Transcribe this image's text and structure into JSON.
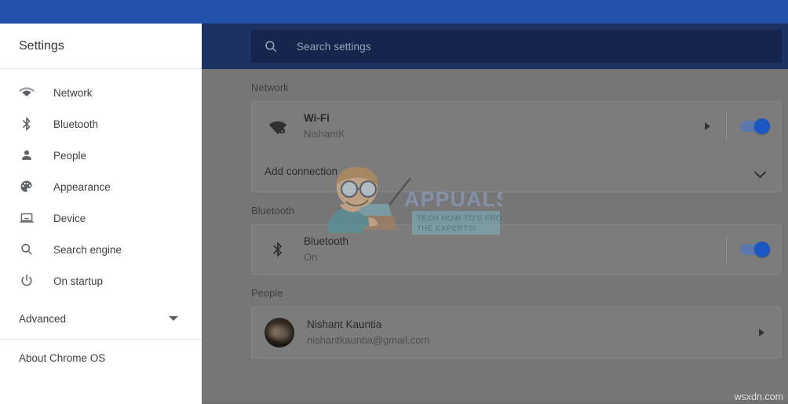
{
  "window": {
    "top_bar_color": "#2351ab",
    "header_color": "#1b3263",
    "dim_overlay_color": "#767676"
  },
  "sidebar": {
    "title": "Settings",
    "items": [
      {
        "label": "Network",
        "icon": "wifi-icon"
      },
      {
        "label": "Bluetooth",
        "icon": "bluetooth-icon"
      },
      {
        "label": "People",
        "icon": "person-icon"
      },
      {
        "label": "Appearance",
        "icon": "palette-icon"
      },
      {
        "label": "Device",
        "icon": "laptop-icon"
      },
      {
        "label": "Search engine",
        "icon": "search-icon"
      },
      {
        "label": "On startup",
        "icon": "power-icon"
      }
    ],
    "advanced": {
      "label": "Advanced",
      "icon": "chevron-down-icon"
    },
    "about": {
      "label": "About Chrome OS"
    }
  },
  "search": {
    "placeholder": "Search settings",
    "value": "",
    "icon": "search-icon"
  },
  "sections": {
    "network": {
      "title": "Network",
      "wifi": {
        "title": "Wi-Fi",
        "subtitle": "NishantK",
        "icon": "wifi-locked-icon",
        "arrow": "triangle-right-icon",
        "toggle_on": true
      },
      "add_connection": {
        "label": "Add connection",
        "icon": "chevron-down-icon"
      }
    },
    "bluetooth": {
      "title": "Bluetooth",
      "row": {
        "title": "Bluetooth",
        "subtitle": "On",
        "icon": "bluetooth-icon",
        "toggle_on": true
      }
    },
    "people": {
      "title": "People",
      "row": {
        "name": "Nishant Kauntia",
        "email": "nishantkauntia@gmail.com",
        "avatar": "user-avatar",
        "arrow": "triangle-right-icon"
      }
    }
  },
  "watermarks": {
    "appuals_title": "APPUALS",
    "appuals_tagline_line1": "TECH HOW-TO'S FROM",
    "appuals_tagline_line2": "THE EXPERTS!",
    "corner": "wsxdn.com"
  }
}
